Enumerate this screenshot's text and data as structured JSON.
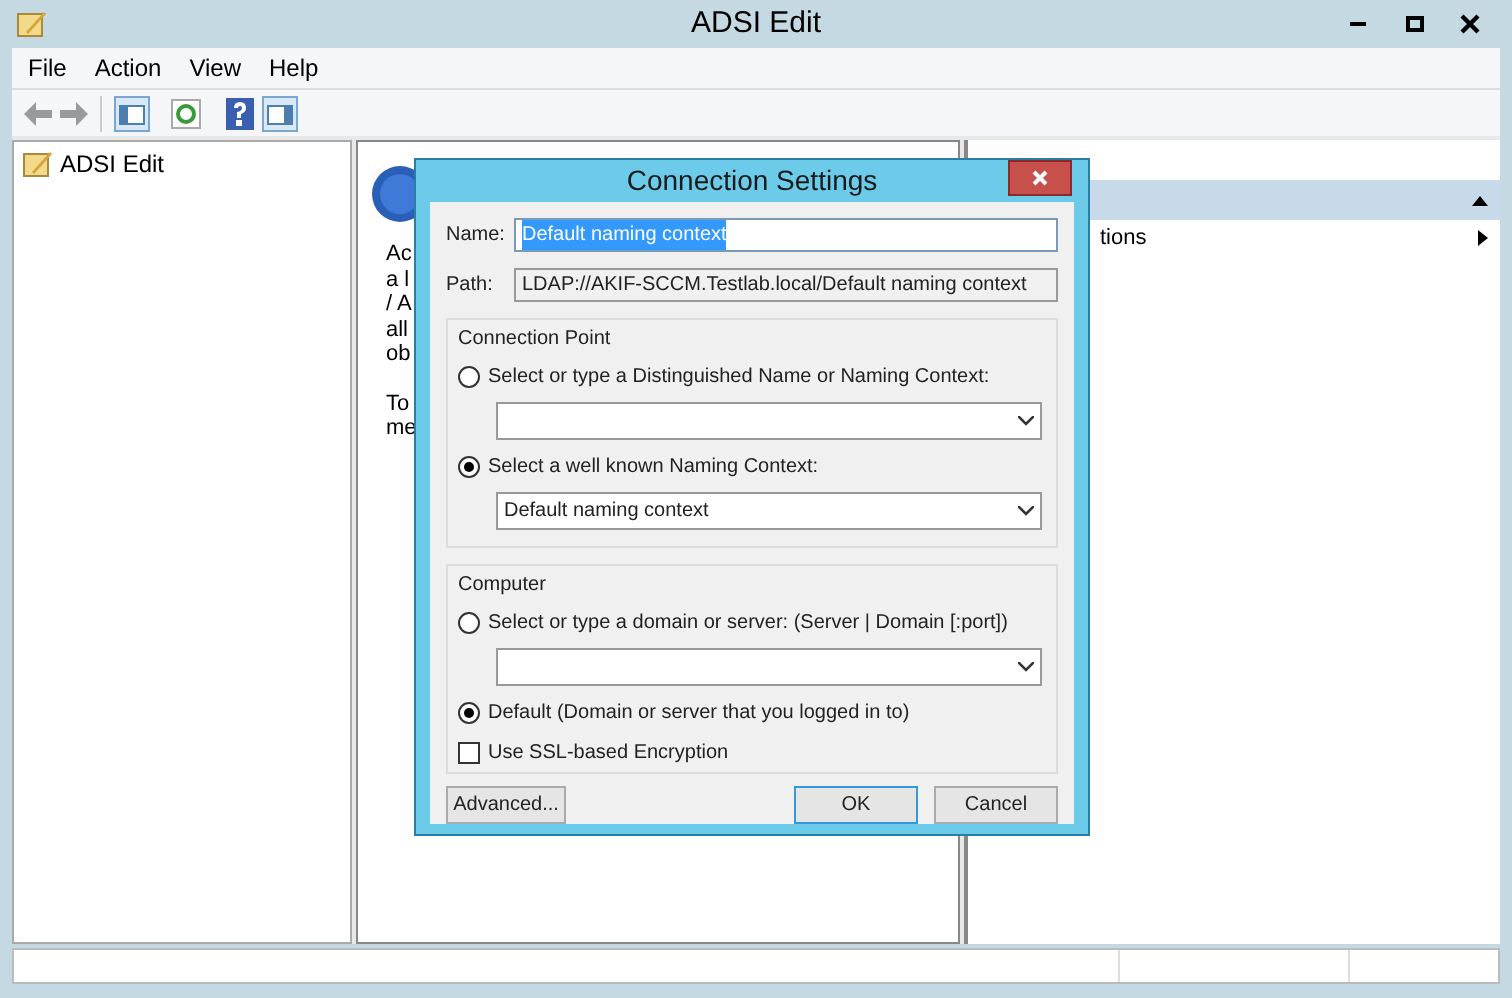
{
  "window": {
    "title": "ADSI Edit"
  },
  "menu": [
    "File",
    "Action",
    "View",
    "Help"
  ],
  "tree": [
    {
      "label": "ADSI Edit",
      "selected": false
    }
  ],
  "middle_pane": {
    "lines": [
      "Ac",
      "a l",
      "/ A",
      "all",
      "ob",
      "To",
      "me"
    ]
  },
  "actions_pane": {
    "items": [
      {
        "label": "tions"
      }
    ]
  },
  "dialog": {
    "title": "Connection Settings",
    "name": {
      "label": "Name:",
      "value": "Default naming context"
    },
    "path": {
      "label": "Path:",
      "value": "LDAP://AKIF-SCCM.Testlab.local/Default naming context"
    },
    "groups": [
      {
        "title": "Connection Point",
        "options": [
          {
            "label": "Select or type a Distinguished Name or Naming Context:",
            "selected": false,
            "kind": "combo"
          },
          {
            "label": "Select a well known Naming Context:",
            "selected": true,
            "kind": "combo",
            "combo": "Default naming context"
          }
        ]
      },
      {
        "title": "Computer",
        "options": [
          {
            "label": "Select or type a domain or server: (Server | Domain [:port])",
            "selected": false,
            "kind": "combo"
          },
          {
            "label": "Default (Domain or server that you logged in to)",
            "selected": true,
            "kind": "plain"
          }
        ],
        "checkbox": {
          "label": "Use SSL-based Encryption",
          "checked": false
        }
      }
    ],
    "buttons": [
      {
        "label": "Advanced...",
        "kind": "left"
      },
      {
        "label": "OK",
        "kind": "default"
      },
      {
        "label": "Cancel",
        "kind": "normal"
      }
    ]
  }
}
